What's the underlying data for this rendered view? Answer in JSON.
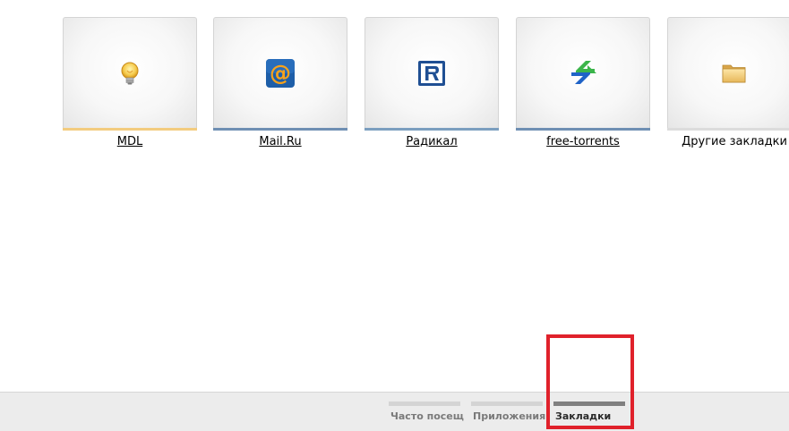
{
  "tiles": [
    {
      "label": "MDL",
      "icon": "lightbulb-icon",
      "bar_color": "#f3cc7f"
    },
    {
      "label": "Mail.Ru",
      "icon": "mailru-at-icon",
      "bar_color": "#6f8fb3"
    },
    {
      "label": "Радикал",
      "icon": "radikal-logo-icon",
      "bar_color": "#7b9ebf"
    },
    {
      "label": "free-torrents",
      "icon": "arrows-icon",
      "bar_color": "#6f8fb3"
    },
    {
      "label": "Другие закладки",
      "icon": "folder-icon",
      "bar_color": "#dcdcdc"
    }
  ],
  "nav": {
    "tabs": [
      {
        "label": "Часто посещ",
        "active": false
      },
      {
        "label": "Приложения",
        "active": false
      },
      {
        "label": "Закладки",
        "active": true
      }
    ]
  },
  "colors": {
    "highlight": "#e0212b",
    "active_tab_bar": "#808080",
    "inactive_tab_bar": "#d4d4d4"
  }
}
